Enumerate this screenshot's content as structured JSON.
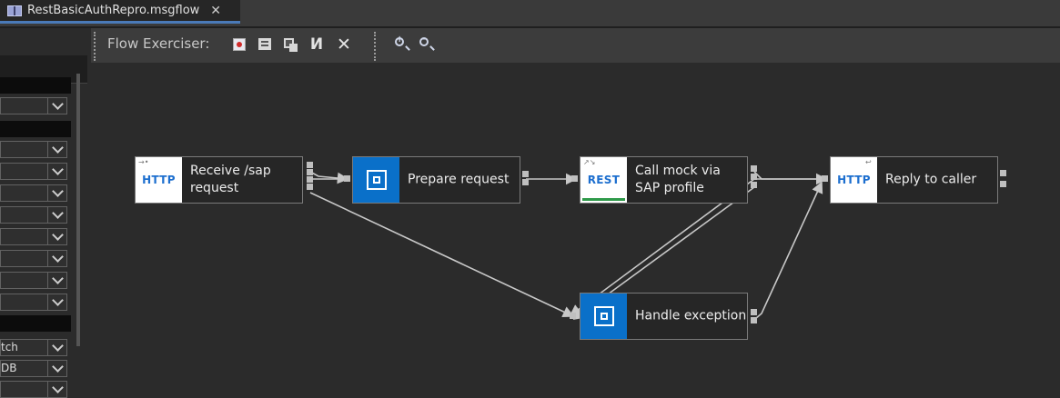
{
  "tab": {
    "title": "RestBasicAuthRepro.msgflow",
    "close_glyph": "✕"
  },
  "toolbar": {
    "label": "Flow Exerciser:",
    "buttons": [
      {
        "name": "record-icon"
      },
      {
        "name": "send-message-icon"
      },
      {
        "name": "view-messages-icon"
      },
      {
        "name": "flow-step-icon"
      },
      {
        "name": "stop-icon"
      },
      {
        "name": "zoom-in-icon"
      },
      {
        "name": "zoom-out-icon"
      }
    ]
  },
  "properties_panel": {
    "rows": [
      "",
      "",
      "",
      "",
      "",
      "",
      "",
      "",
      "",
      "tch",
      "DB",
      ""
    ]
  },
  "nodes": [
    {
      "id": "receive",
      "icon_text": "HTTP",
      "label": "Receive /sap\nrequest",
      "icon_style": "white"
    },
    {
      "id": "prepare",
      "icon_text": "",
      "label": "Prepare request",
      "icon_style": "blue"
    },
    {
      "id": "callmock",
      "icon_text": "REST",
      "label": "Call mock via\nSAP profile",
      "icon_style": "white"
    },
    {
      "id": "reply",
      "icon_text": "HTTP",
      "label": "Reply to caller",
      "icon_style": "white"
    },
    {
      "id": "handle",
      "icon_text": "",
      "label": "Handle exception",
      "icon_style": "blue"
    }
  ],
  "colors": {
    "accent": "#0a70c9",
    "canvas": "#2b2b2b",
    "wire": "#c8c8c8"
  }
}
